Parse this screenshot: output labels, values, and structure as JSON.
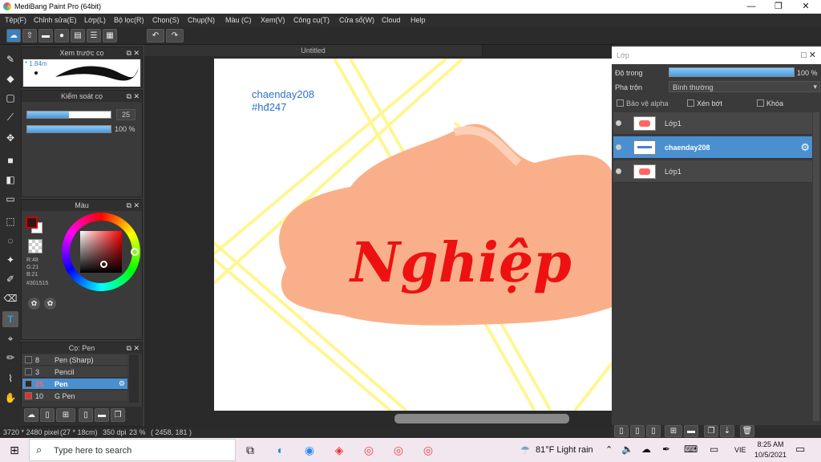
{
  "window": {
    "title": "MediBang Paint Pro (64bit)",
    "minimize": "—",
    "maximize": "❐",
    "close": "✕"
  },
  "menu": [
    "Tệp(F)",
    "Chỉnh sửa(E)",
    "Lớp(L)",
    "Bộ lọc(R)",
    "Chọn(S)",
    "Chụp(N)",
    "Màu (C)",
    "Xem(V)",
    "Công cụ(T)",
    "Cửa sổ(W)",
    "Cloud",
    "Help"
  ],
  "toolbar": {
    "undo": "↶",
    "redo": "↷"
  },
  "brush_preview": {
    "title": "Xem trước cọ",
    "size_label": "1.84m"
  },
  "brush_control": {
    "title": "Kiểm soát cọ",
    "size_value": "25",
    "size_fraction": 0.5,
    "opacity_value": "100 %",
    "opacity_fraction": 1.0
  },
  "color_panel": {
    "title": "Màu",
    "r": "R:48",
    "g": "G:21",
    "b": "B:21",
    "hex": "#301515",
    "primary_color": "#301515",
    "secondary_color": "#ffffff"
  },
  "brush_list": {
    "title": "Cọ: Pen",
    "items": [
      {
        "num": "8",
        "name": "Pen (Sharp)",
        "swatch": "#3a3a3a"
      },
      {
        "num": "3",
        "name": "Pencil",
        "swatch": "#3a3a3a"
      },
      {
        "num": "25",
        "name": "Pen",
        "swatch": "#2a2a2a",
        "selected": true
      },
      {
        "num": "10",
        "name": "G Pen",
        "swatch": "#e03030"
      }
    ]
  },
  "document": {
    "tab": "Untitled"
  },
  "canvas_art": {
    "line1": "chaenday208",
    "line2": "#hđ247",
    "word": "Nghiệp",
    "word_color": "#ee1111",
    "blob_color": "#f9b08a",
    "line_color": "#fff580"
  },
  "layers": {
    "title": "Lớp",
    "opacity_label": "Độ trong",
    "opacity_value": "100 %",
    "opacity_fraction": 1.0,
    "blend_label": "Pha trộn",
    "blend_value": "Bình thường",
    "protect_alpha": "Bảo vệ alpha",
    "clipping": "Xén bớt",
    "lock": "Khóa",
    "items": [
      {
        "name": "Lớp1"
      },
      {
        "name": "chaenday208",
        "selected": true
      },
      {
        "name": "Lớp1"
      }
    ]
  },
  "status": {
    "size": "3720 * 2480 pixel",
    "cm": "(27 * 18cm)",
    "dpi": "350 dpi",
    "zoom": "23 %",
    "coords": "( 2458, 181 )"
  },
  "taskbar": {
    "search_placeholder": "Type here to search",
    "weather": "81°F  Light rain",
    "lang": "VIE",
    "time": "8:25 AM",
    "date": "10/5/2021"
  }
}
